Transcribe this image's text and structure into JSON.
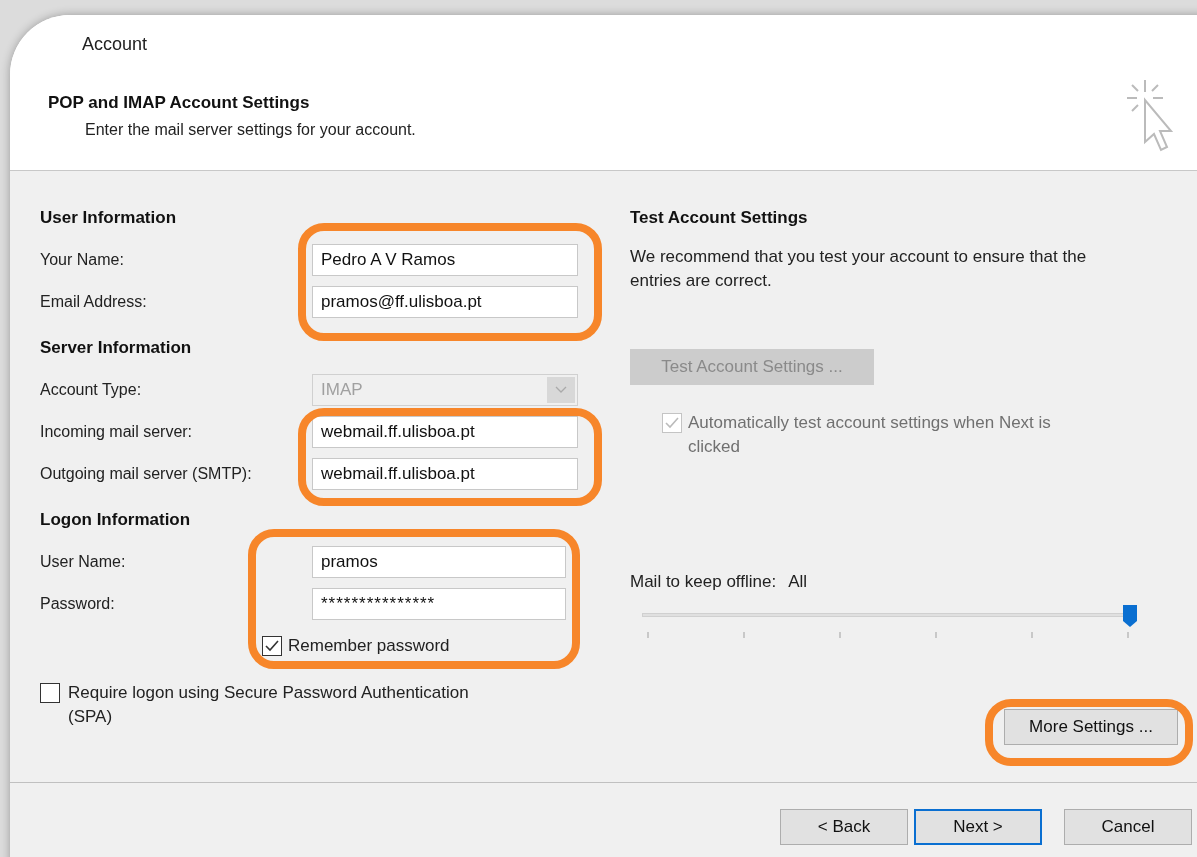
{
  "window": {
    "title": "Account"
  },
  "header": {
    "title": "POP and IMAP Account Settings",
    "subtitle": "Enter the mail server settings for your account."
  },
  "sections": [
    {
      "heading": "User Information",
      "fields": [
        {
          "label": "Your Name:",
          "value": "Pedro A V Ramos",
          "kind": "text",
          "disabled": false
        },
        {
          "label": "Email Address:",
          "value": "pramos@ff.ulisboa.pt",
          "kind": "text",
          "disabled": false
        }
      ]
    },
    {
      "heading": "Server Information",
      "fields": [
        {
          "label": "Account Type:",
          "value": "IMAP",
          "kind": "dropdown",
          "disabled": true
        },
        {
          "label": "Incoming mail server:",
          "value": "webmail.ff.ulisboa.pt",
          "kind": "text",
          "disabled": false
        },
        {
          "label": "Outgoing mail server (SMTP):",
          "value": "webmail.ff.ulisboa.pt",
          "kind": "text",
          "disabled": false
        }
      ]
    },
    {
      "heading": "Logon Information",
      "fields": [
        {
          "label": "User Name:",
          "value": "pramos",
          "kind": "text",
          "disabled": false
        },
        {
          "label": "Password:",
          "value": "***************",
          "kind": "password",
          "disabled": false
        }
      ]
    }
  ],
  "remember_password": {
    "label": "Remember password",
    "checked": true
  },
  "spa": {
    "label": "Require logon using Secure Password Authentication (SPA)",
    "checked": false
  },
  "test": {
    "heading": "Test Account Settings",
    "description": "We recommend that you test your account to ensure that the entries are correct.",
    "button": {
      "label": "Test Account Settings ...",
      "disabled": true
    },
    "auto_test": {
      "label": "Automatically test account settings when Next is clicked",
      "checked": true,
      "disabled": true
    }
  },
  "offline": {
    "label": "Mail to keep offline:",
    "value": "All",
    "level": 1
  },
  "more_settings": {
    "label": "More Settings ..."
  },
  "footer_buttons": [
    {
      "label": "< Back",
      "focused": false
    },
    {
      "label": "Next >",
      "focused": true
    },
    {
      "label": "Cancel",
      "focused": false
    }
  ]
}
